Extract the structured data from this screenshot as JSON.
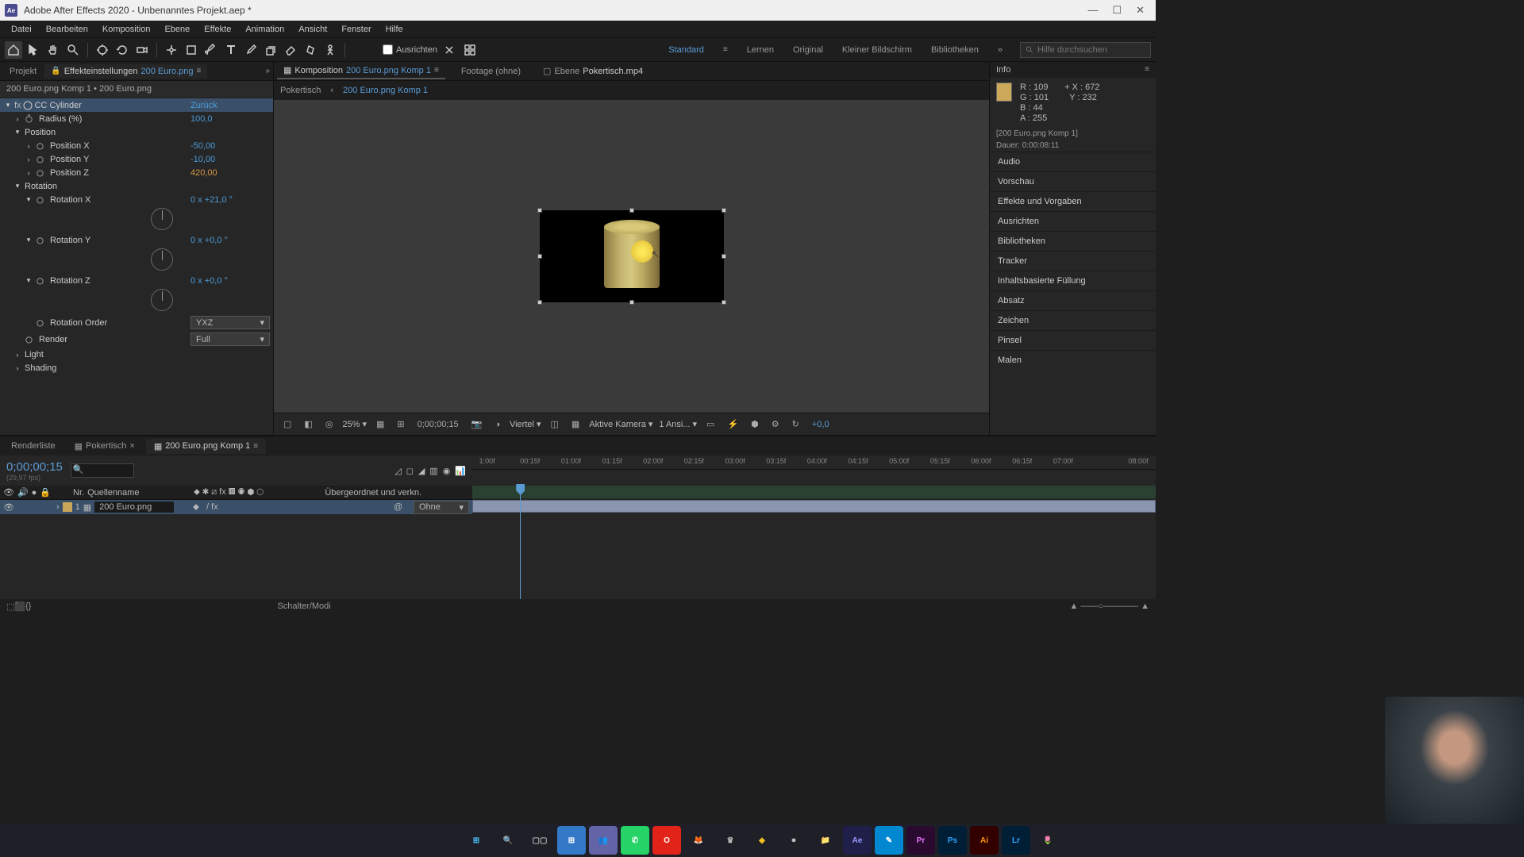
{
  "titlebar": {
    "app_short": "Ae",
    "title": "Adobe After Effects 2020 - Unbenanntes Projekt.aep *"
  },
  "menu": {
    "items": [
      "Datei",
      "Bearbeiten",
      "Komposition",
      "Ebene",
      "Effekte",
      "Animation",
      "Ansicht",
      "Fenster",
      "Hilfe"
    ]
  },
  "toolbar": {
    "align_label": "Ausrichten",
    "search_placeholder": "Hilfe durchsuchen"
  },
  "workspaces": {
    "items": [
      "Standard",
      "Lernen",
      "Original",
      "Kleiner Bildschirm",
      "Bibliotheken"
    ],
    "arrows": "»"
  },
  "left_tabs": {
    "project": "Projekt",
    "effect_controls": "Effekteinstellungen",
    "effect_arg": "200 Euro.png",
    "arrows": "»"
  },
  "left_breadcrumb": "200 Euro.png Komp 1 • 200 Euro.png",
  "effect": {
    "name": "CC Cylinder",
    "reset": "Zurück",
    "radius_label": "Radius (%)",
    "radius_val": "100,0",
    "position": "Position",
    "pos_x": "Position X",
    "pos_x_val": "-50,00",
    "pos_y": "Position Y",
    "pos_y_val": "-10,00",
    "pos_z": "Position Z",
    "pos_z_val": "420,00",
    "rotation": "Rotation",
    "rot_x": "Rotation X",
    "rot_x_val": "0 x +21,0 °",
    "rot_y": "Rotation Y",
    "rot_y_val": "0 x +0,0 °",
    "rot_z": "Rotation Z",
    "rot_z_val": "0 x +0,0 °",
    "rot_order": "Rotation Order",
    "rot_order_val": "YXZ",
    "render": "Render",
    "render_val": "Full",
    "light": "Light",
    "shading": "Shading"
  },
  "comp_tabs": {
    "comp": "Komposition",
    "comp_name": "200 Euro.png Komp 1",
    "footage": "Footage (ohne)",
    "layer": "Ebene",
    "layer_name": "Pokertisch.mp4"
  },
  "comp_bc": {
    "a": "Pokertisch",
    "sep": "‹",
    "b": "200 Euro.png Komp 1"
  },
  "viewer_footer": {
    "zoom": "25%",
    "time": "0;00;00;15",
    "quality": "Viertel",
    "camera": "Aktive Kamera",
    "views": "1 Ansi...",
    "exposure": "+0,0"
  },
  "info_panel": {
    "title": "Info",
    "r": "R :",
    "r_v": "109",
    "g": "G :",
    "g_v": "101",
    "b": "B :",
    "b_v": "44",
    "a": "A :",
    "a_v": "255",
    "x": "X :",
    "x_v": "672",
    "y": "Y :",
    "y_v": "232",
    "layer_info": "[200 Euro.png Komp 1]",
    "duration": "Dauer: 0:00:08:11"
  },
  "right_panels": [
    "Audio",
    "Vorschau",
    "Effekte und Vorgaben",
    "Ausrichten",
    "Bibliotheken",
    "Tracker",
    "Inhaltsbasierte Füllung",
    "Absatz",
    "Zeichen",
    "Pinsel",
    "Malen"
  ],
  "tl_tabs": {
    "render": "Renderliste",
    "poker": "Pokertisch",
    "active": "200 Euro.png Komp 1"
  },
  "timecode": "0;00;00;15",
  "tl_fps": "(29,97 fps)",
  "layer_cols": {
    "nr": "Nr.",
    "source": "Quellenname",
    "parent": "Übergeordnet und verkn."
  },
  "layer_row": {
    "index": "1",
    "name": "200 Euro.png",
    "parent_val": "Ohne"
  },
  "tl_ruler": [
    "1:00f",
    "00:15f",
    "01:00f",
    "01:15f",
    "02:00f",
    "02:15f",
    "03:00f",
    "03:15f",
    "04:00f",
    "04:15f",
    "05:00f",
    "05:15f",
    "06:00f",
    "06:15f",
    "07:00f",
    "08:00f"
  ],
  "tl_footer": "Schalter/Modi"
}
